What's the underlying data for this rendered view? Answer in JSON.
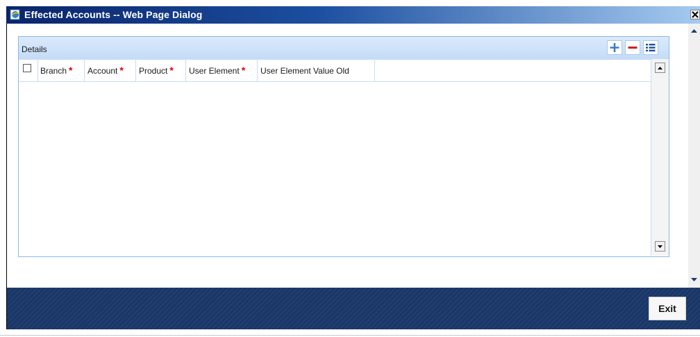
{
  "window": {
    "title": "Effected Accounts -- Web Page Dialog",
    "close_glyph": "✕"
  },
  "panel": {
    "label": "Details",
    "toolbar": {
      "add_icon": "plus-icon",
      "remove_icon": "minus-icon",
      "view_icon": "list-icon"
    },
    "columns": [
      {
        "label": "Branch",
        "required": "*"
      },
      {
        "label": "Account",
        "required": "*"
      },
      {
        "label": "Product",
        "required": "*"
      },
      {
        "label": "User Element",
        "required": "*"
      },
      {
        "label": "User Element Value Old",
        "required": ""
      }
    ],
    "rows": []
  },
  "footer": {
    "exit_label": "Exit"
  },
  "colors": {
    "title_gradient_start": "#0a246a",
    "panel_header": "#c4dcf7",
    "footer": "#1e3b6c",
    "required_marker": "#e00000"
  }
}
